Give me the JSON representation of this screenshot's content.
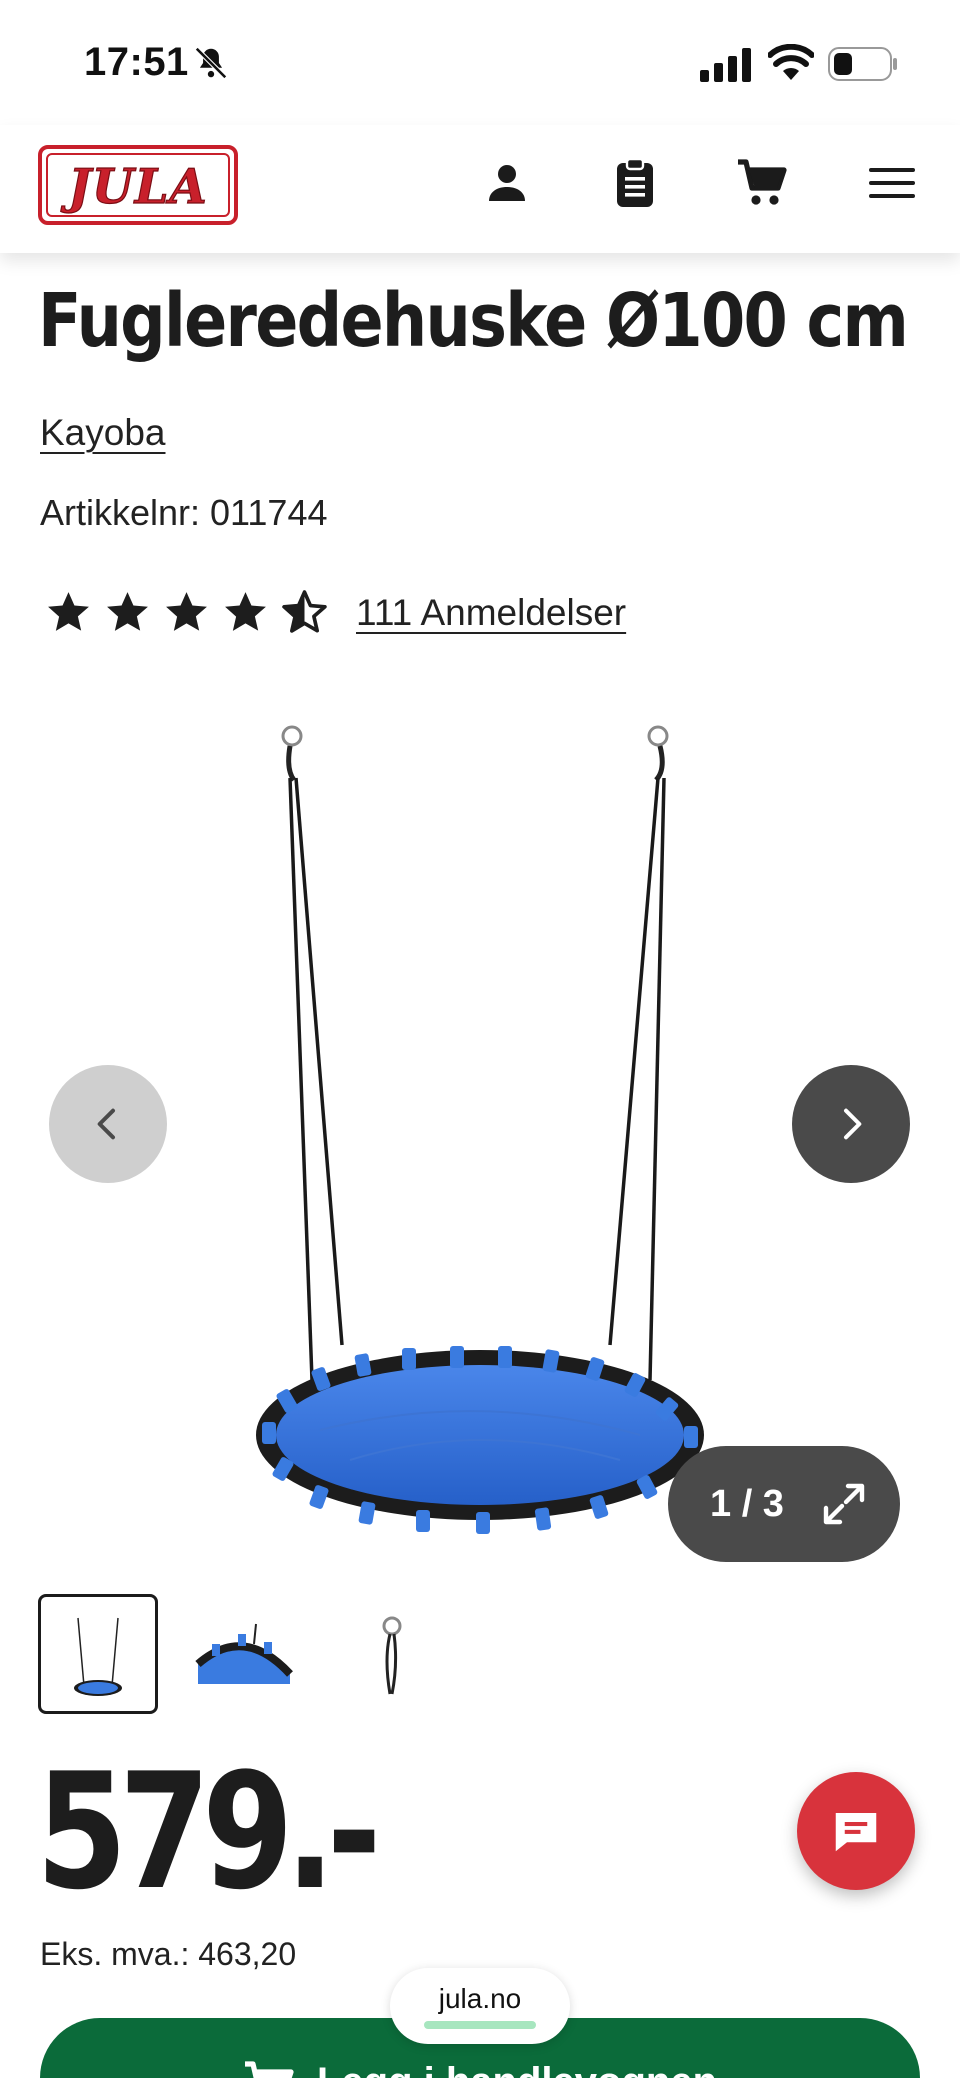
{
  "status_bar": {
    "time": "17:51",
    "icons": [
      "bell-off-icon",
      "cellular-signal-icon",
      "wifi-icon",
      "battery-icon"
    ]
  },
  "header": {
    "logo_text": "JULA",
    "brand_color": "#c8202b",
    "icons": [
      "user-icon",
      "clipboard-icon",
      "cart-icon",
      "menu-icon"
    ]
  },
  "product": {
    "title": "Fugleredehuske Ø100 cm",
    "brand": "Kayoba",
    "article_number": "Artikkelnr: 011744",
    "rating": 4.5,
    "rating_max": 5,
    "reviews_label": "111 Anmeldelser",
    "price": "579.-",
    "price_ex_vat": "Eks. mva.: 463,20"
  },
  "gallery": {
    "counter": "1 / 3",
    "current_index": 1,
    "total": 3,
    "thumbnails": [
      "swing-full",
      "swing-rim-detail",
      "hanging-hook-detail"
    ]
  },
  "actions": {
    "add_to_cart": "Legg i handlevognen"
  },
  "browser": {
    "url": "jula.no"
  },
  "colors": {
    "accent_green": "#0b6b3a",
    "chat_red": "#d8333c",
    "swing_blue": "#2f6fd8"
  }
}
